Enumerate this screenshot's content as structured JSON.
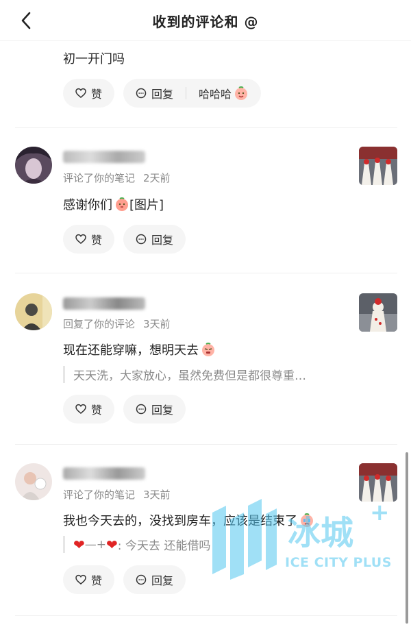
{
  "header": {
    "title": "收到的评论和 @"
  },
  "comments": [
    {
      "content": "初一开门吗",
      "actions": {
        "like": "赞",
        "reply": "回复",
        "extra_reply": "哈哈哈"
      }
    },
    {
      "meta": "评论了你的笔记",
      "time": "2天前",
      "content": "感谢你们",
      "content_suffix": "[图片]",
      "actions": {
        "like": "赞",
        "reply": "回复"
      }
    },
    {
      "meta": "回复了你的评论",
      "time": "3天前",
      "content": "现在还能穿嘛，想明天去",
      "quote": "天天洗，大家放心，虽然免费但是都很尊重…",
      "actions": {
        "like": "赞",
        "reply": "回复"
      }
    },
    {
      "meta": "评论了你的笔记",
      "time": "3天前",
      "content": "我也今天去的，没找到房车，应该是结束了",
      "quote": "—+",
      "quote_text": ": 今天去 还能借吗",
      "actions": {
        "like": "赞",
        "reply": "回复"
      }
    }
  ],
  "watermark": {
    "cn": "冰城",
    "plus": "+",
    "en": "ICE CITY PLUS"
  },
  "colors": {
    "watermark": "#54c7f0",
    "heart": "#e02424"
  },
  "icons": [
    "back-arrow-icon",
    "heart-outline-icon",
    "comment-icon",
    "emoji-icon"
  ]
}
